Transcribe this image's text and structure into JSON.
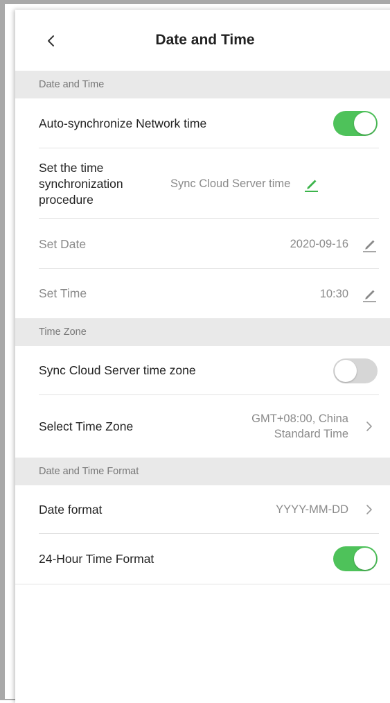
{
  "header": {
    "title": "Date and Time"
  },
  "sections": {
    "date_time": "Date and Time",
    "time_zone": "Time Zone",
    "format": "Date and Time Format"
  },
  "rows": {
    "auto_sync": {
      "label": "Auto-synchronize Network time",
      "toggle": true
    },
    "sync_procedure": {
      "label": "Set the time synchronization procedure",
      "value": "Sync Cloud Server time"
    },
    "set_date": {
      "label": "Set Date",
      "value": "2020-09-16"
    },
    "set_time": {
      "label": "Set Time",
      "value": "10:30"
    },
    "sync_tz": {
      "label": "Sync Cloud Server time zone",
      "toggle": false
    },
    "select_tz": {
      "label": "Select Time Zone",
      "value": "GMT+08:00, China Standard Time"
    },
    "date_format": {
      "label": "Date format",
      "value": "YYYY-MM-DD"
    },
    "hour_format": {
      "label": "24-Hour Time Format",
      "toggle": true
    }
  },
  "colors": {
    "accent_green": "#4ec25a",
    "toggle_off": "#d6d6d6",
    "section_bg": "#e9e9e9",
    "edit_active": "#3cb44b",
    "edit_inactive": "#8a8a8a"
  },
  "icons": {
    "back": "back-chevron-icon",
    "edit": "pencil-icon",
    "next": "chevron-right-icon"
  }
}
